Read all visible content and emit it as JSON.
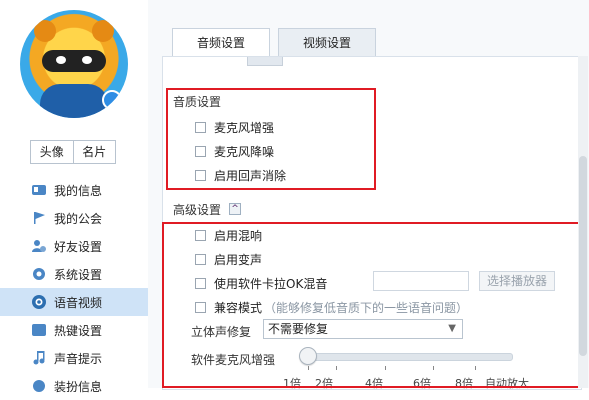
{
  "sidebar": {
    "avatar_tabs": [
      "头像",
      "名片"
    ],
    "items": [
      {
        "label": "我的信息",
        "icon": "id-card-icon"
      },
      {
        "label": "我的公会",
        "icon": "flag-icon"
      },
      {
        "label": "好友设置",
        "icon": "user-gear-icon"
      },
      {
        "label": "系统设置",
        "icon": "gear-icon"
      },
      {
        "label": "语音视频",
        "icon": "camera-icon",
        "active": true
      },
      {
        "label": "热键设置",
        "icon": "keyboard-icon"
      },
      {
        "label": "声音提示",
        "icon": "music-note-icon"
      },
      {
        "label": "装扮信息",
        "icon": "badge-icon"
      }
    ]
  },
  "tabs": [
    {
      "label": "音频设置",
      "active": true
    },
    {
      "label": "视频设置",
      "active": false
    }
  ],
  "audio_quality": {
    "title": "音质设置",
    "options": [
      "麦克风增强",
      "麦克风降噪",
      "启用回声消除"
    ]
  },
  "advanced": {
    "title": "高级设置",
    "expand_symbol": "^",
    "reverb_label": "启用混响",
    "voice_change_label": "启用变声",
    "karaoke_label": "使用软件卡拉OK混音",
    "karaoke_input_value": "",
    "choose_player_label": "选择播放器",
    "compat_label": "兼容模式",
    "compat_hint": "（能够修复低音质下的一些语音问题）",
    "stereo_label": "立体声修复",
    "stereo_value": "不需要修复",
    "mic_boost_label": "软件麦克风增强",
    "mic_boost_ticks": [
      "1倍",
      "2倍",
      "4倍",
      "6倍",
      "8倍",
      "自动放大"
    ],
    "mic_boost_level": 0
  },
  "colors": {
    "highlight": "#e01b24",
    "active_nav": "#cfe3f7"
  }
}
